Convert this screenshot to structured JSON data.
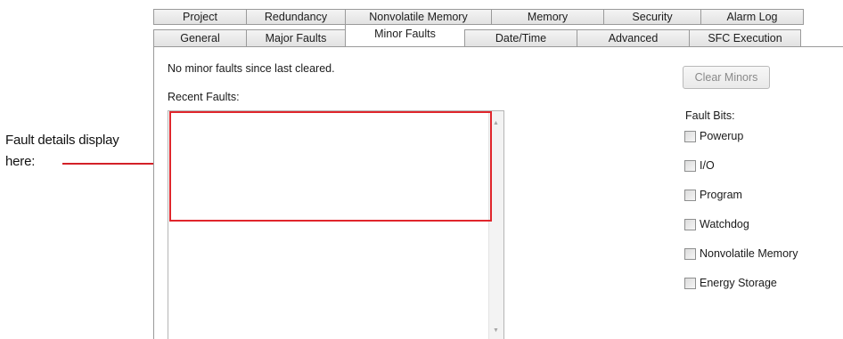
{
  "callout": {
    "line1": "Fault details display",
    "line2": "here:"
  },
  "tabs": {
    "top": [
      "Project",
      "Redundancy",
      "Nonvolatile Memory",
      "Memory",
      "Security",
      "Alarm Log"
    ],
    "bottom": [
      "General",
      "Major Faults",
      "Minor Faults",
      "Date/Time",
      "Advanced",
      "SFC Execution"
    ],
    "active": "Minor Faults"
  },
  "status_text": "No minor faults since last cleared.",
  "recent_faults_label": "Recent Faults:",
  "recent_faults_value": "",
  "clear_button_label": "Clear Minors",
  "fault_bits_label": "Fault Bits:",
  "fault_bits": [
    {
      "label": "Powerup",
      "checked": false
    },
    {
      "label": "I/O",
      "checked": false
    },
    {
      "label": "Program",
      "checked": false
    },
    {
      "label": "Watchdog",
      "checked": false
    },
    {
      "label": "Nonvolatile Memory",
      "checked": false
    },
    {
      "label": "Energy Storage",
      "checked": false
    }
  ],
  "colors": {
    "callout_red": "#e0262c",
    "tab_border": "#9a9a9a",
    "disabled_text": "#8a8a8a"
  },
  "icons": {
    "scroll_up": "scroll-up-arrow-icon",
    "scroll_down": "scroll-down-arrow-icon"
  }
}
